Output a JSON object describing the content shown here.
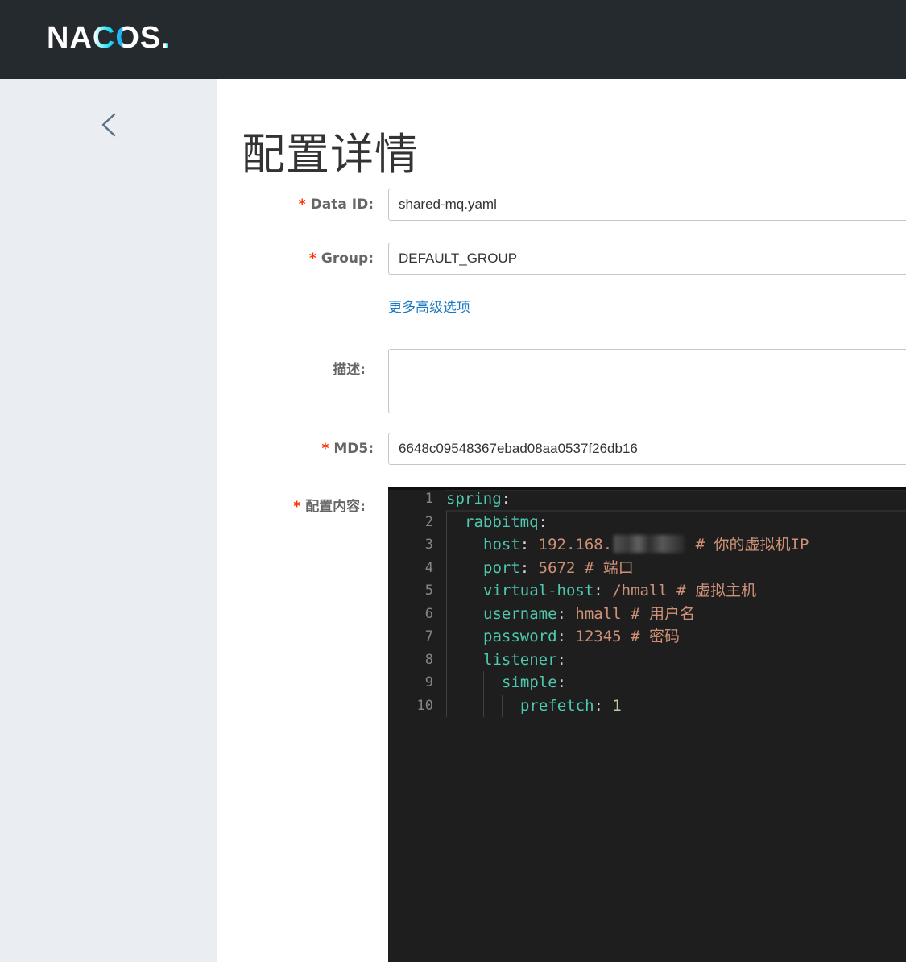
{
  "header": {
    "logo_text": "NACOS."
  },
  "sidebar": {
    "back_icon": "chevron-left-icon"
  },
  "page": {
    "title": "配置详情"
  },
  "form": {
    "data_id": {
      "required_mark": "*",
      "label": "Data ID:",
      "value": "shared-mq.yaml"
    },
    "group": {
      "required_mark": "*",
      "label": "Group:",
      "value": "DEFAULT_GROUP"
    },
    "advanced_link": "更多高级选项",
    "description": {
      "label": "描述:",
      "value": ""
    },
    "md5": {
      "required_mark": "*",
      "label": "MD5:",
      "value": "6648c09548367ebad08aa0537f26db16"
    },
    "content": {
      "required_mark": "*",
      "label": "配置内容:"
    }
  },
  "editor": {
    "lines": [
      {
        "no": "1",
        "indent": 0,
        "key": "spring",
        "value": "",
        "comment": ""
      },
      {
        "no": "2",
        "indent": 1,
        "key": "rabbitmq",
        "value": "",
        "comment": ""
      },
      {
        "no": "3",
        "indent": 2,
        "key": "host",
        "value": "192.168.",
        "comment": "# 你的虚拟机IP",
        "redacted": true
      },
      {
        "no": "4",
        "indent": 2,
        "key": "port",
        "value": "5672",
        "comment": "# 端口"
      },
      {
        "no": "5",
        "indent": 2,
        "key": "virtual-host",
        "value": "/hmall",
        "comment": "# 虚拟主机"
      },
      {
        "no": "6",
        "indent": 2,
        "key": "username",
        "value": "hmall",
        "comment": "# 用户名"
      },
      {
        "no": "7",
        "indent": 2,
        "key": "password",
        "value": "12345",
        "comment": "# 密码"
      },
      {
        "no": "8",
        "indent": 2,
        "key": "listener",
        "value": "",
        "comment": ""
      },
      {
        "no": "9",
        "indent": 3,
        "key": "simple",
        "value": "",
        "comment": ""
      },
      {
        "no": "10",
        "indent": 4,
        "key": "prefetch",
        "value": "1",
        "comment": "",
        "numeric": true
      }
    ],
    "colors": {
      "background": "#1e1e1e",
      "key": "#4ec9b0",
      "string": "#ce9178",
      "number": "#b5cea8",
      "line_number": "#858585"
    }
  },
  "colors": {
    "topbar": "#252a2f",
    "sidebar": "#eaeef3",
    "required": "#ff3000",
    "link": "#1a78c2"
  }
}
